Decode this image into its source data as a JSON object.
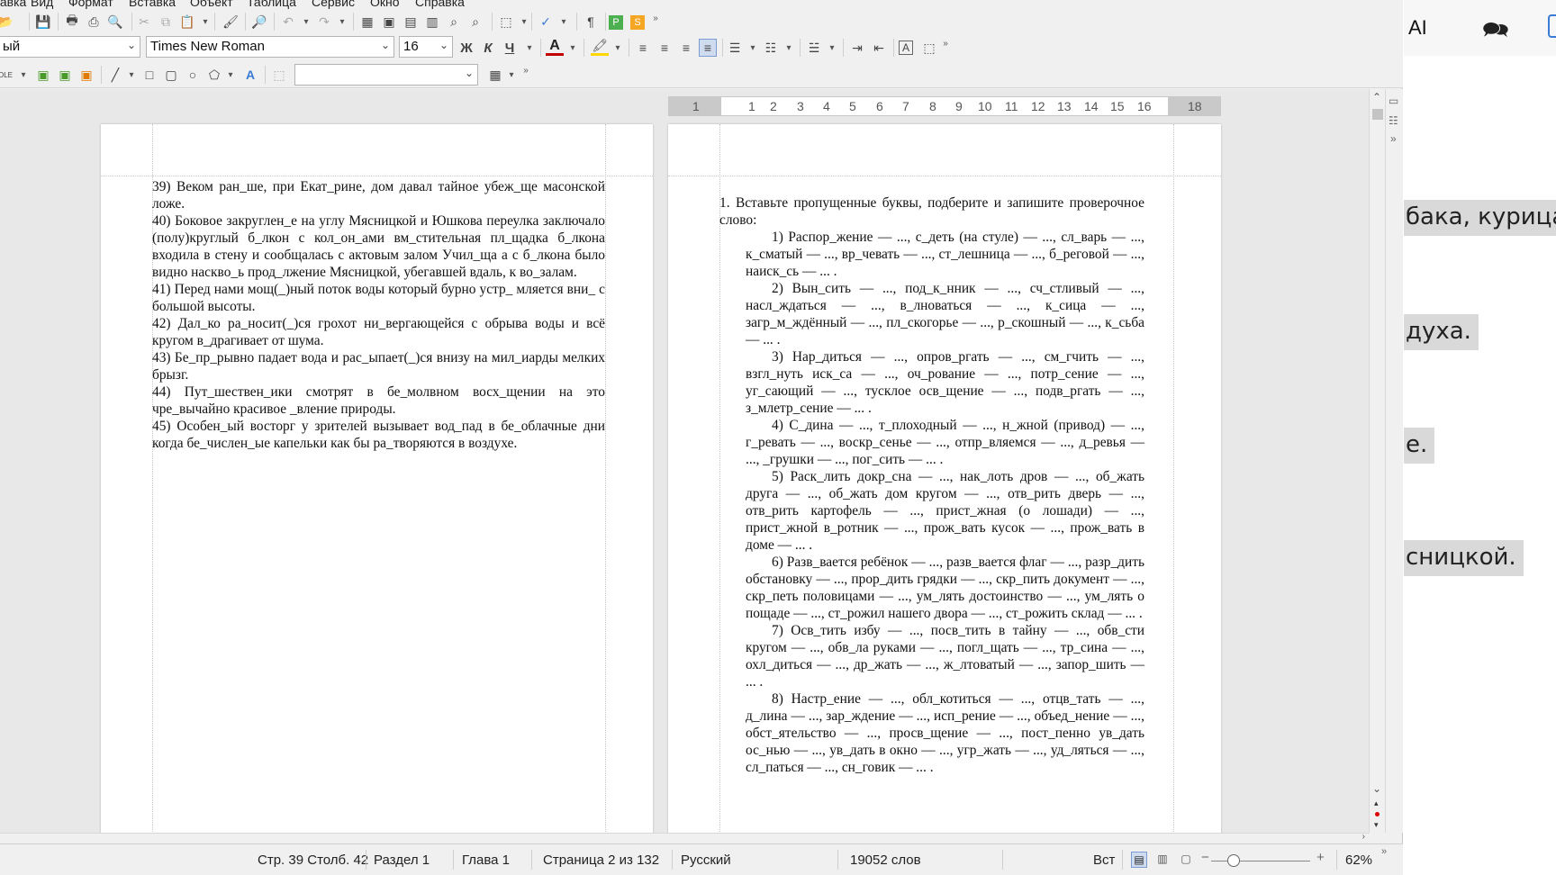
{
  "menu": {
    "items": [
      "Правка",
      "Вид",
      "Формат",
      "Вставка",
      "Объект",
      "Таблица",
      "Сервис",
      "Окно",
      "Справка"
    ]
  },
  "toolbar": {
    "paragraph_style": "ый",
    "font_name": "Times New Roman",
    "font_size": "16",
    "bold_label": "Ж",
    "italic_label": "К",
    "underline_label": "Ч",
    "font_color_label": "А",
    "text_label_a": "A",
    "styles_field": ""
  },
  "ruler": {
    "numbers": [
      "1",
      "1",
      "2",
      "3",
      "4",
      "5",
      "6",
      "7",
      "8",
      "9",
      "10",
      "11",
      "12",
      "13",
      "14",
      "15",
      "16",
      "18"
    ]
  },
  "document": {
    "left_page": [
      "39) Веком ран_ше, при Екат_рине, дом давал тайное убеж_ще масонской ложе.",
      "40) Боковое закруглен_е на углу Мясницкой и Юшкова переулка заключало (полу)круглый б_лкон с кол_он_ами вм_стительная пл_щадка б_лкона входила в стену и сообщалась с актовым залом Учил_ща а с б_лкона было видно насквo_ь прод_лжение Мясницкой, убегавшей вдаль, к во_залам.",
      "41) Перед нами мощ(_)ный поток воды который бурно устр_ мляется вни_ с большой высоты.",
      "42) Дал_ко ра_носит(_)ся грохот ни_вергающейся с обрыва воды и всё кругом в_драгивает от шума.",
      "43) Бе_пр_рывно падает вода и рас_ыпает(_)ся внизу на мил_иарды мелких брызг.",
      "44) Пут_шествен_ики смотрят в бе_молвном восх_щении на это чре_вычайно красивое _вление природы.",
      "45) Особен_ый восторг у зрителей вызывает вод_пад в бе_облачные дни когда бе_числен_ые капельки как бы ра_творяются в воздухе."
    ],
    "right_intro": "1. Вставьте пропущенные буквы, подберите и запишите проверочное слово:",
    "right_items": [
      "1) Распор_жение — ..., с_деть (на стуле) — ..., сл_варь — ..., к_сматый — ..., вр_чевать — ..., ст_лешница — ..., б_реговой — ..., наиск_сь — ... .",
      "2) Вын_сить — ..., под_к_нник — ..., сч_стливый — ..., насл_ждаться — ..., в_лноваться — ..., к_сица — ..., загр_м_ждённый — ..., пл_скогорье — ..., р_скошный — ..., к_сьба — ... .",
      "3) Нар_диться — ..., опров_ргать — ..., см_гчить — ..., взгл_нуть иск_са — ..., оч_рование — ..., потр_сение — ..., уг_сающий — ..., тусклое осв_щение — ..., подв_ргать — ..., з_млетр_сение — ... .",
      "4) С_дина — ..., т_плоходный — ..., н_жной (привод) — ..., г_ревать — ..., воскр_сенье — ..., отпр_вляемся — ..., д_ревья — ..., _грушки — ..., пог_сить — ... .",
      "5) Раск_лить докр_сна — ..., нак_лоть дров — ..., об_жать друга — ..., об_жать дом кругом — ..., отв_рить дверь — ..., отв_рить картофель — ..., прист_жная (о лошади) — ..., прист_жной в_ротник — ..., прож_вать кусок — ..., прож_вать в доме — ... .",
      "6) Разв_вается ребёнок — ..., разв_вается флаг — ..., разр_дить обстановку — ..., прор_дить грядки — ..., скр_пить документ — ..., скр_петь половицами — ..., ум_лять достоинство — ..., ум_лять о пощаде — ..., ст_рожил нашего двора — ..., ст_рожить склад — ... .",
      "7) Осв_тить избу — ..., посв_тить в тайну — ..., обв_сти кругом — ..., обв_ла руками — ..., погл_щать — ..., тр_сина — ..., охл_диться — ..., др_жать — ..., ж_лтоватый — ..., запор_шить — ... .",
      "8) Настр_ение — ..., обл_котиться — ..., отцв_тать — ..., д_лина — ..., зар_ждение — ..., исп_рение — ..., объед_нение — ..., обст_ятельство — ..., просв_щение — ..., пост_пенно ув_дать ос_нью — ..., ув_дать в окно — ..., угр_жать — ..., уд_ляться — ..., сл_паться — ..., сн_говик — ... ."
    ]
  },
  "status": {
    "page_col": "Стр. 39 Столб. 42",
    "section": "Раздел 1",
    "chapter": "Глава 1",
    "page_of": "Страница 2 из 132",
    "language": "Русский",
    "word_count": "19052 слов",
    "insert_mode": "Вст",
    "zoom": "62%"
  },
  "side_panel": {
    "ai_label": "AI",
    "fragments": [
      "бака, курица,",
      "духа.",
      "е.",
      "сницкой."
    ]
  },
  "colors": {
    "font_color": "#c00000",
    "highlight": "#ffd700",
    "green_icon": "#4caf50",
    "orange_icon": "#f5a623"
  }
}
